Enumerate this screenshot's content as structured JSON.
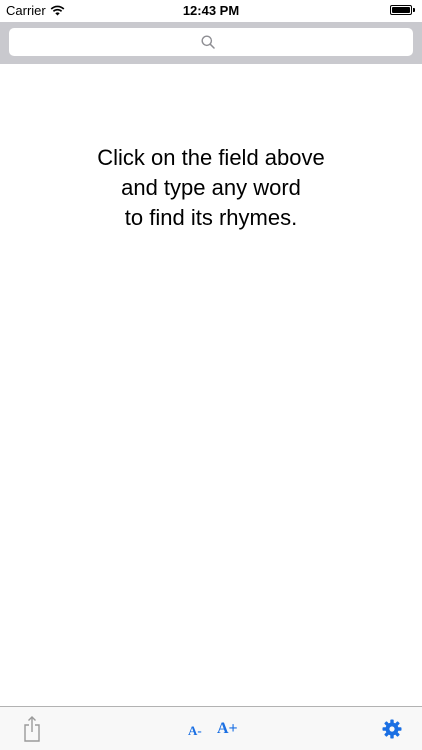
{
  "status_bar": {
    "carrier": "Carrier",
    "time": "12:43 PM",
    "wifi_icon": "wifi-icon",
    "battery_icon": "battery-icon"
  },
  "search": {
    "placeholder": "",
    "value": "",
    "icon": "search-icon"
  },
  "main": {
    "instruction_lines": [
      "Click on the field above",
      "and type any word",
      "to find its rhymes."
    ]
  },
  "toolbar": {
    "share_icon": "share-icon",
    "font_decrease_label": "A-",
    "font_increase_label": "A+",
    "settings_icon": "gear-icon"
  },
  "colors": {
    "accent": "#1a6fe3",
    "search_bar_bg": "#c9c9ce",
    "toolbar_bg": "#f8f8f8"
  }
}
